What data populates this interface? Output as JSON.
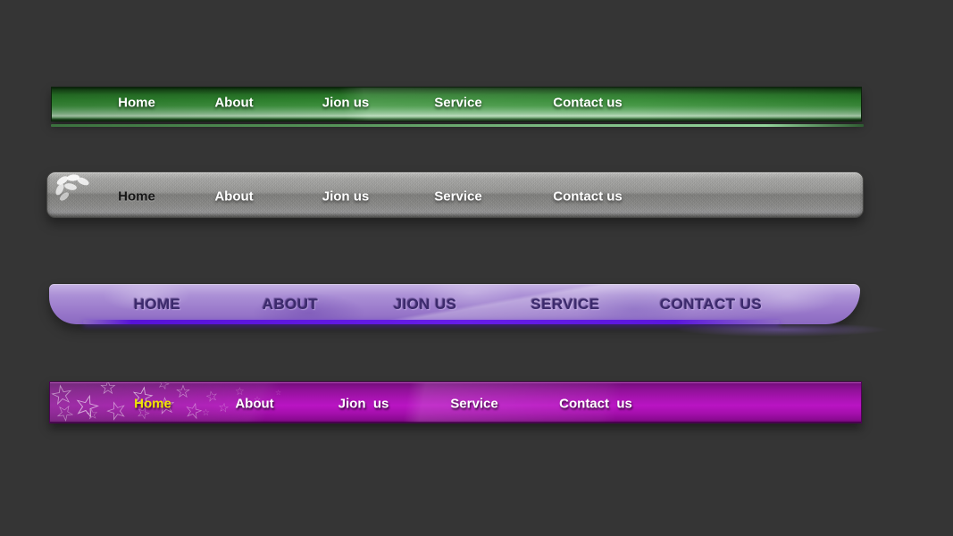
{
  "page": {
    "background": "#353535"
  },
  "navbars": {
    "green": {
      "style": "glossy-green",
      "items": [
        {
          "label": "Home"
        },
        {
          "label": "About"
        },
        {
          "label": "Jion us"
        },
        {
          "label": "Service"
        },
        {
          "label": "Contact us"
        }
      ],
      "colors": {
        "base": "#328a32",
        "dark_edge": "#0a260a",
        "highlight": "#b4d7b6",
        "underline": "#7cbb82",
        "text": "#ffffff"
      }
    },
    "gray": {
      "style": "textured-gray",
      "icon": "paw-flower-icon",
      "active_item": "Home",
      "items": [
        {
          "label": "Home"
        },
        {
          "label": "About"
        },
        {
          "label": "Jion us"
        },
        {
          "label": "Service"
        },
        {
          "label": "Contact us"
        }
      ],
      "colors": {
        "base": "#9b9b99",
        "text": "#ffffff",
        "active_text": "#171717"
      }
    },
    "purple": {
      "style": "rounded-lavender",
      "items": [
        {
          "label": "HOME"
        },
        {
          "label": "ABOUT"
        },
        {
          "label": "JION US"
        },
        {
          "label": "SERVICE"
        },
        {
          "label": "CONTACT US"
        }
      ],
      "colors": {
        "base": "#a78bd2",
        "text": "#3c2a6d",
        "bottom_stripe": "#671de9"
      }
    },
    "magenta": {
      "style": "starry-magenta",
      "active_item": "Home",
      "items": [
        {
          "label": "Home"
        },
        {
          "label": "About"
        },
        {
          "label": "Jion  us"
        },
        {
          "label": "Service"
        },
        {
          "label": "Contact  us"
        }
      ],
      "colors": {
        "base": "#b914c3",
        "text": "#ffffff",
        "active_text": "#f2e600"
      }
    }
  }
}
